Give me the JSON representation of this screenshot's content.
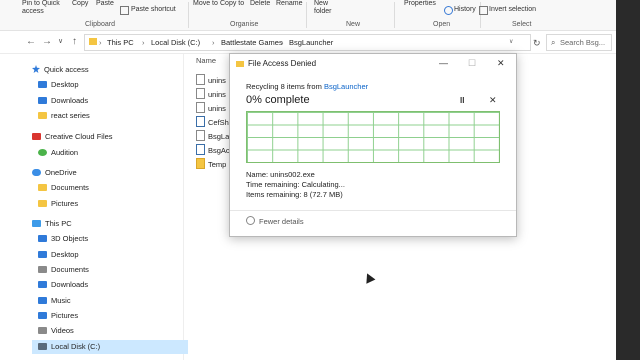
{
  "ribbon": {
    "items": [
      "Pin to Quick access",
      "Copy",
      "Paste",
      "Paste shortcut",
      "Move to",
      "Copy to",
      "Delete",
      "Rename",
      "New folder",
      "Properties",
      "History",
      "Invert selection"
    ],
    "groups": [
      "Clipboard",
      "Organise",
      "New",
      "Open",
      "Select"
    ]
  },
  "address": {
    "path": [
      "This PC",
      "Local Disk (C:)",
      "Battlestate Games",
      "BsgLauncher"
    ],
    "search_placeholder": "Search Bsg..."
  },
  "nav": {
    "quick_access": "Quick access",
    "quick_items": [
      "Desktop",
      "Downloads",
      "react series"
    ],
    "creative_cloud": "Creative Cloud Files",
    "audition": "Audition",
    "onedrive": "OneDrive",
    "onedrive_items": [
      "Documents",
      "Pictures"
    ],
    "this_pc": "This PC",
    "pc_items": [
      "3D Objects",
      "Desktop",
      "Documents",
      "Downloads",
      "Music",
      "Pictures",
      "Videos",
      "Local Disk (C:)"
    ]
  },
  "content": {
    "column_name": "Name",
    "files": [
      "unins",
      "unins",
      "unins",
      "CefSh",
      "BsgLa",
      "BsgAc",
      "Temp"
    ]
  },
  "dialog": {
    "title": "File Access Denied",
    "recycling_prefix": "Recycling 8 items from",
    "recycling_location": "BsgLauncher",
    "percent": "0% complete",
    "pause_label": "II",
    "close_label": "✕",
    "name_line": "Name:  unins002.exe",
    "time_line": "Time remaining:  Calculating...",
    "items_line": "Items remaining:  8 (72.7 MB)",
    "fewer_details": "Fewer details",
    "window_buttons": [
      "—",
      "☐",
      "✕"
    ]
  },
  "progress": 0
}
